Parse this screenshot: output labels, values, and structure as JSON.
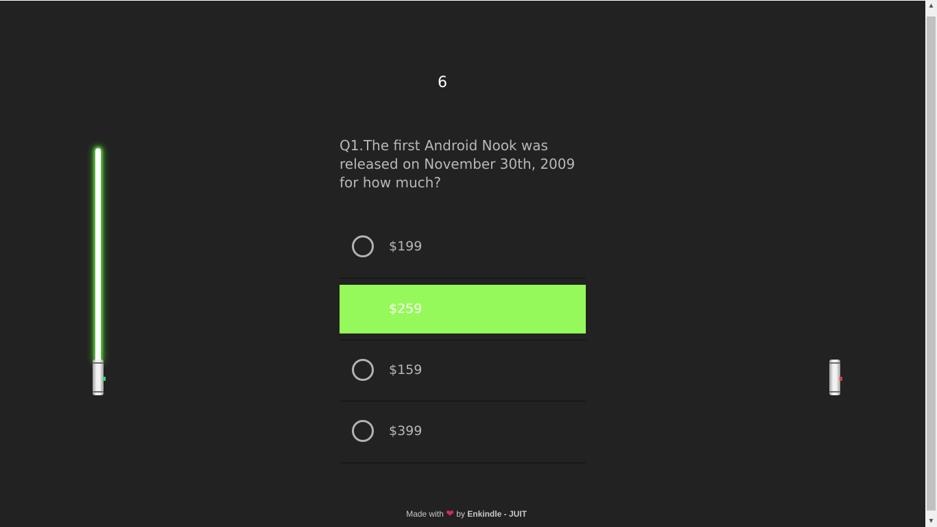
{
  "timer": "6",
  "question": {
    "text": "Q1.The first Android Nook was released on November 30th, 2009 for how much?"
  },
  "options": [
    {
      "label": "$199",
      "selected": false
    },
    {
      "label": "$259",
      "selected": true
    },
    {
      "label": "$159",
      "selected": false
    },
    {
      "label": "$399",
      "selected": false
    }
  ],
  "footer": {
    "made_with": "Made with",
    "by": "by",
    "author": "Enkindle - JUIT"
  },
  "colors": {
    "background": "#222222",
    "selected_option": "#95f95b",
    "saber_glow": "#6bd64b",
    "heart": "#d12b5a",
    "left_hilt_button": "#3fd86a",
    "right_hilt_button": "#e23b3b"
  },
  "sabers": {
    "left_icon": "green-lightsaber-icon",
    "right_icon": "lightsaber-hilt-icon"
  }
}
